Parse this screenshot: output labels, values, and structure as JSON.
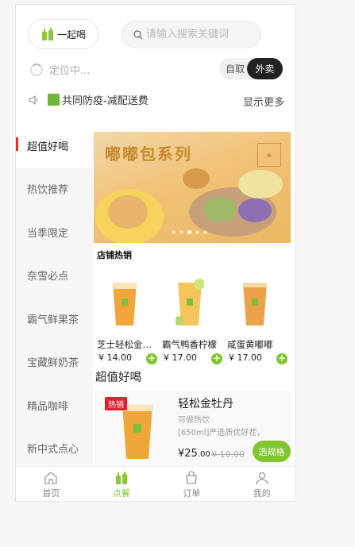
{
  "header": {
    "brand_label": "一起喝",
    "search_placeholder": "请输入搜索关键词"
  },
  "location": {
    "text": "定位中..."
  },
  "order_mode": {
    "pickup": "自取",
    "delivery": "外卖",
    "selected": "delivery"
  },
  "notice": {
    "text": "共同防疫-减配送费",
    "more": "显示更多"
  },
  "sidebar": {
    "items": [
      {
        "label": "超值好喝",
        "active": true
      },
      {
        "label": "热饮推荐",
        "active": false
      },
      {
        "label": "当季限定",
        "active": false
      },
      {
        "label": "奈雪必点",
        "active": false
      },
      {
        "label": "霸气鲜果茶",
        "active": false
      },
      {
        "label": "宝藏鲜奶茶",
        "active": false
      },
      {
        "label": "精品咖啡",
        "active": false
      },
      {
        "label": "新中式点心",
        "active": false
      }
    ]
  },
  "banner": {
    "title": "嘟嘟包系列",
    "slides": 5,
    "current": 3
  },
  "hot_section": {
    "title": "店铺热销",
    "items": [
      {
        "name": "芝士轻松金牡丹",
        "price": "¥ 14.00"
      },
      {
        "name": "霸气鸭香柠檬",
        "price": "¥ 17.00"
      },
      {
        "name": "咸蛋黄嘟嘟",
        "price": "¥ 17.00"
      }
    ]
  },
  "category": {
    "title": "超值好喝",
    "product": {
      "badge": "热销",
      "name": "轻松金牡丹",
      "desc1": "可做热饮",
      "desc2": "[650ml]严选质优好茬，",
      "price_int": "¥25",
      "price_dec": ".00",
      "orig_price": "¥ 10.00",
      "button": "选规格"
    }
  },
  "tabbar": {
    "items": [
      {
        "label": "首页",
        "icon": "home-icon",
        "active": false
      },
      {
        "label": "点餐",
        "icon": "cups-icon",
        "active": true
      },
      {
        "label": "订单",
        "icon": "bag-icon",
        "active": false
      },
      {
        "label": "我的",
        "icon": "person-icon",
        "active": false
      }
    ]
  },
  "colors": {
    "accent": "#7cc62a",
    "active_marker": "#e42e2e",
    "badge": "#e3202e"
  }
}
